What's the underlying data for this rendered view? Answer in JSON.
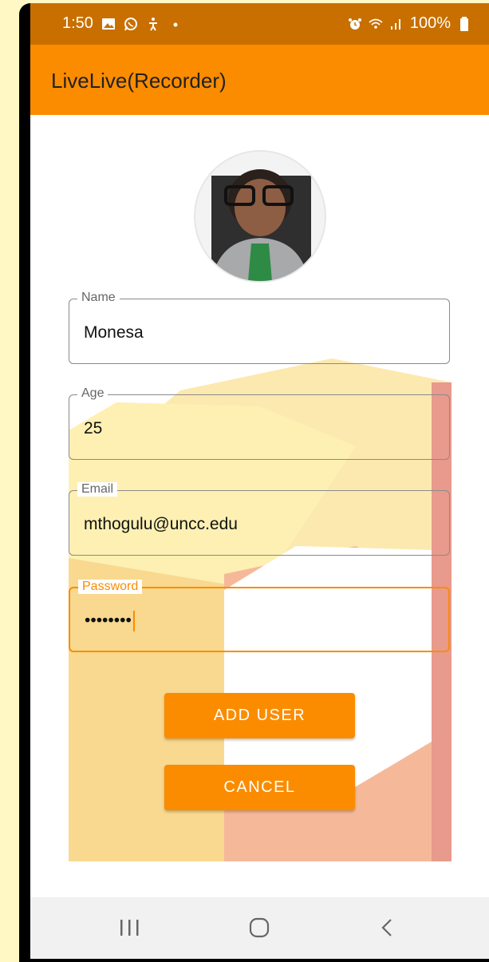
{
  "status_bar": {
    "time": "1:50",
    "battery": "100%",
    "left_icons": [
      "gallery-icon",
      "whatsapp-icon",
      "accessibility-icon",
      "dot-icon"
    ],
    "right_icons": [
      "alarm-icon",
      "wifi-icon",
      "signal-icon",
      "battery-icon"
    ]
  },
  "app_bar": {
    "title": "LiveLive(Recorder)",
    "color": "#fb8c00"
  },
  "form": {
    "name": {
      "label": "Name",
      "value": "Monesa"
    },
    "age": {
      "label": "Age",
      "value": "25"
    },
    "email": {
      "label": "Email",
      "value": "mthogulu@uncc.edu"
    },
    "password": {
      "label": "Password",
      "value": "••••••••"
    }
  },
  "buttons": {
    "add_user": "ADD USER",
    "cancel": "CANCEL"
  },
  "nav_bar": {
    "icons": [
      "recent-apps-icon",
      "home-icon",
      "back-icon"
    ]
  },
  "colors": {
    "accent": "#fb8c00",
    "status_bar": "#c86f00",
    "page_background": "#fff7c4"
  }
}
